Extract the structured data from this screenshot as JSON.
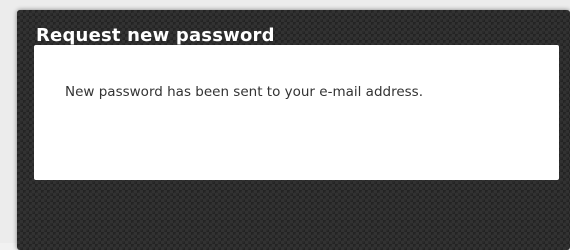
{
  "dialog": {
    "title": "Request new password",
    "message": "New password has been sent to your e-mail address."
  },
  "colors": {
    "panel_background": "#2b2b2b",
    "title_text": "#ffffff",
    "content_background": "#ffffff",
    "message_text": "#333333"
  }
}
